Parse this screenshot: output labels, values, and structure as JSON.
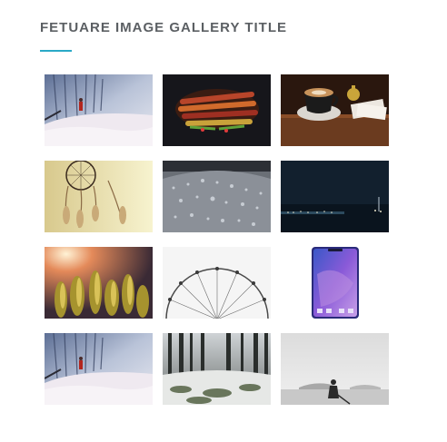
{
  "gallery": {
    "title": "FETUARE IMAGE GALLERY TITLE",
    "accent_color": "#2aa9c7",
    "images": [
      {
        "subject": "winter-forest-walker"
      },
      {
        "subject": "grilled-food"
      },
      {
        "subject": "coffee-cup"
      },
      {
        "subject": "dreamcatcher"
      },
      {
        "subject": "water-droplets"
      },
      {
        "subject": "night-coastline"
      },
      {
        "subject": "cactus-sunset"
      },
      {
        "subject": "ferris-wheel"
      },
      {
        "subject": "smartphone"
      },
      {
        "subject": "winter-forest-walker"
      },
      {
        "subject": "snowy-forest"
      },
      {
        "subject": "mist-photographer"
      }
    ]
  }
}
